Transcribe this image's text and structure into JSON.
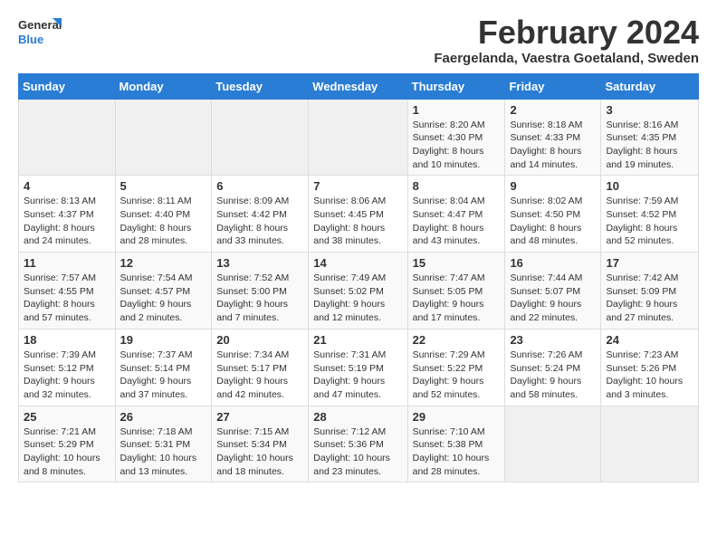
{
  "header": {
    "logo_line1": "General",
    "logo_line2": "Blue",
    "title": "February 2024",
    "subtitle": "Faergelanda, Vaestra Goetaland, Sweden"
  },
  "weekdays": [
    "Sunday",
    "Monday",
    "Tuesday",
    "Wednesday",
    "Thursday",
    "Friday",
    "Saturday"
  ],
  "weeks": [
    [
      {
        "day": "",
        "info": ""
      },
      {
        "day": "",
        "info": ""
      },
      {
        "day": "",
        "info": ""
      },
      {
        "day": "",
        "info": ""
      },
      {
        "day": "1",
        "info": "Sunrise: 8:20 AM\nSunset: 4:30 PM\nDaylight: 8 hours\nand 10 minutes."
      },
      {
        "day": "2",
        "info": "Sunrise: 8:18 AM\nSunset: 4:33 PM\nDaylight: 8 hours\nand 14 minutes."
      },
      {
        "day": "3",
        "info": "Sunrise: 8:16 AM\nSunset: 4:35 PM\nDaylight: 8 hours\nand 19 minutes."
      }
    ],
    [
      {
        "day": "4",
        "info": "Sunrise: 8:13 AM\nSunset: 4:37 PM\nDaylight: 8 hours\nand 24 minutes."
      },
      {
        "day": "5",
        "info": "Sunrise: 8:11 AM\nSunset: 4:40 PM\nDaylight: 8 hours\nand 28 minutes."
      },
      {
        "day": "6",
        "info": "Sunrise: 8:09 AM\nSunset: 4:42 PM\nDaylight: 8 hours\nand 33 minutes."
      },
      {
        "day": "7",
        "info": "Sunrise: 8:06 AM\nSunset: 4:45 PM\nDaylight: 8 hours\nand 38 minutes."
      },
      {
        "day": "8",
        "info": "Sunrise: 8:04 AM\nSunset: 4:47 PM\nDaylight: 8 hours\nand 43 minutes."
      },
      {
        "day": "9",
        "info": "Sunrise: 8:02 AM\nSunset: 4:50 PM\nDaylight: 8 hours\nand 48 minutes."
      },
      {
        "day": "10",
        "info": "Sunrise: 7:59 AM\nSunset: 4:52 PM\nDaylight: 8 hours\nand 52 minutes."
      }
    ],
    [
      {
        "day": "11",
        "info": "Sunrise: 7:57 AM\nSunset: 4:55 PM\nDaylight: 8 hours\nand 57 minutes."
      },
      {
        "day": "12",
        "info": "Sunrise: 7:54 AM\nSunset: 4:57 PM\nDaylight: 9 hours\nand 2 minutes."
      },
      {
        "day": "13",
        "info": "Sunrise: 7:52 AM\nSunset: 5:00 PM\nDaylight: 9 hours\nand 7 minutes."
      },
      {
        "day": "14",
        "info": "Sunrise: 7:49 AM\nSunset: 5:02 PM\nDaylight: 9 hours\nand 12 minutes."
      },
      {
        "day": "15",
        "info": "Sunrise: 7:47 AM\nSunset: 5:05 PM\nDaylight: 9 hours\nand 17 minutes."
      },
      {
        "day": "16",
        "info": "Sunrise: 7:44 AM\nSunset: 5:07 PM\nDaylight: 9 hours\nand 22 minutes."
      },
      {
        "day": "17",
        "info": "Sunrise: 7:42 AM\nSunset: 5:09 PM\nDaylight: 9 hours\nand 27 minutes."
      }
    ],
    [
      {
        "day": "18",
        "info": "Sunrise: 7:39 AM\nSunset: 5:12 PM\nDaylight: 9 hours\nand 32 minutes."
      },
      {
        "day": "19",
        "info": "Sunrise: 7:37 AM\nSunset: 5:14 PM\nDaylight: 9 hours\nand 37 minutes."
      },
      {
        "day": "20",
        "info": "Sunrise: 7:34 AM\nSunset: 5:17 PM\nDaylight: 9 hours\nand 42 minutes."
      },
      {
        "day": "21",
        "info": "Sunrise: 7:31 AM\nSunset: 5:19 PM\nDaylight: 9 hours\nand 47 minutes."
      },
      {
        "day": "22",
        "info": "Sunrise: 7:29 AM\nSunset: 5:22 PM\nDaylight: 9 hours\nand 52 minutes."
      },
      {
        "day": "23",
        "info": "Sunrise: 7:26 AM\nSunset: 5:24 PM\nDaylight: 9 hours\nand 58 minutes."
      },
      {
        "day": "24",
        "info": "Sunrise: 7:23 AM\nSunset: 5:26 PM\nDaylight: 10 hours\nand 3 minutes."
      }
    ],
    [
      {
        "day": "25",
        "info": "Sunrise: 7:21 AM\nSunset: 5:29 PM\nDaylight: 10 hours\nand 8 minutes."
      },
      {
        "day": "26",
        "info": "Sunrise: 7:18 AM\nSunset: 5:31 PM\nDaylight: 10 hours\nand 13 minutes."
      },
      {
        "day": "27",
        "info": "Sunrise: 7:15 AM\nSunset: 5:34 PM\nDaylight: 10 hours\nand 18 minutes."
      },
      {
        "day": "28",
        "info": "Sunrise: 7:12 AM\nSunset: 5:36 PM\nDaylight: 10 hours\nand 23 minutes."
      },
      {
        "day": "29",
        "info": "Sunrise: 7:10 AM\nSunset: 5:38 PM\nDaylight: 10 hours\nand 28 minutes."
      },
      {
        "day": "",
        "info": ""
      },
      {
        "day": "",
        "info": ""
      }
    ]
  ]
}
